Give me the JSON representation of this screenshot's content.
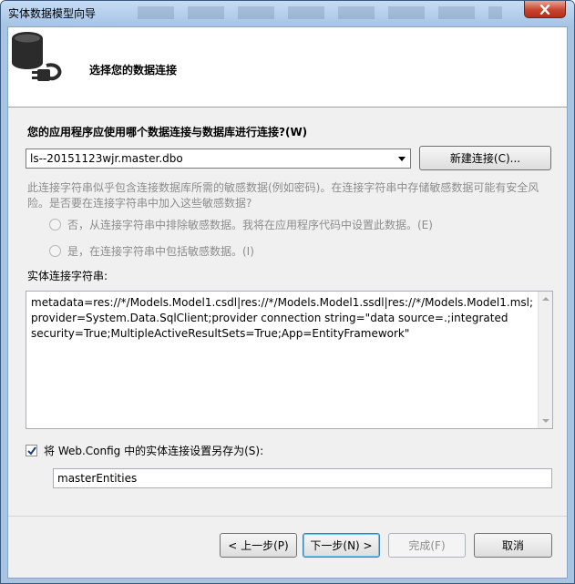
{
  "window": {
    "title": "实体数据模型向导"
  },
  "header": {
    "title": "选择您的数据连接"
  },
  "connection": {
    "question": "您的应用程序应使用哪个数据连接与数据库进行连接?(W)",
    "selected": "ls--20151123wjr.master.dbo",
    "new_button_label": "新建连接(C)..."
  },
  "sensitive": {
    "message": "此连接字符串似乎包含连接数据库所需的敏感数据(例如密码)。在连接字符串中存储敏感数据可能有安全风险。是否要在连接字符串中加入这些敏感数据?",
    "option_no": "否，从连接字符串中排除敏感数据。我将在应用程序代码中设置此数据。(E)",
    "option_yes": "是，在连接字符串中包括敏感数据。(I)"
  },
  "entity_connection": {
    "label": "实体连接字符串:",
    "value": "metadata=res://*/Models.Model1.csdl|res://*/Models.Model1.ssdl|res://*/Models.Model1.msl;provider=System.Data.SqlClient;provider connection string=\"data source=.;integrated security=True;MultipleActiveResultSets=True;App=EntityFramework\""
  },
  "save": {
    "checkbox_label": "将 Web.Config 中的实体连接设置另存为(S):",
    "checked": true,
    "name": "masterEntities"
  },
  "buttons": {
    "back": "< 上一步(P)",
    "next": "下一步(N) >",
    "finish": "完成(F)",
    "cancel": "取消"
  }
}
